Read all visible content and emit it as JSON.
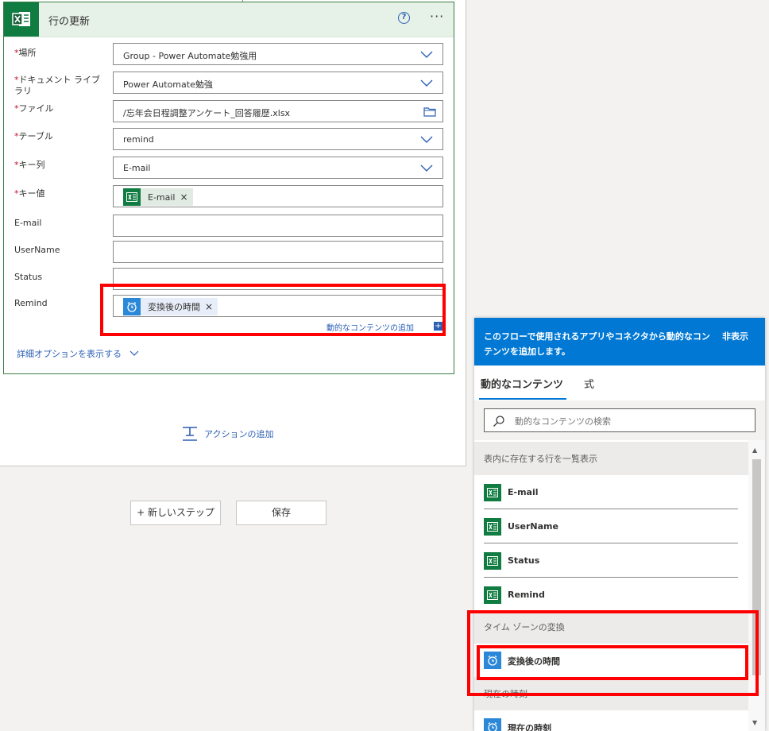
{
  "card": {
    "title": "行の更新",
    "help": "?",
    "more": "···",
    "fields": {
      "location": {
        "label": "場所",
        "value": "Group - Power Automate勉強用"
      },
      "doc_library": {
        "label_1": "ドキュメント ライブ",
        "label_2": "ラリ",
        "value": "Power Automate勉強"
      },
      "file": {
        "label": "ファイル",
        "value": "/忘年会日程調整アンケート_回答履歴.xlsx"
      },
      "table": {
        "label": "テーブル",
        "value": "remind"
      },
      "key_column": {
        "label": "キー列",
        "value": "E-mail"
      },
      "key_value": {
        "label": "キー値",
        "token": "E-mail"
      },
      "email": {
        "label": "E-mail",
        "value": ""
      },
      "username": {
        "label": "UserName",
        "value": ""
      },
      "status": {
        "label": "Status",
        "value": ""
      },
      "remind": {
        "label": "Remind",
        "token": "変換後の時間"
      }
    },
    "required_mark": "*",
    "token_close": "×",
    "add_dynamic": "動的なコンテンツの追加",
    "add_dynamic_plus": "+",
    "advanced_options": "詳細オプションを表示する"
  },
  "canvas": {
    "add_action": "アクションの追加",
    "new_step": "+ 新しいステップ",
    "save": "保存"
  },
  "panel": {
    "description": "このフローで使用されるアプリやコネクタから動的なコンテンツを追加します。",
    "hide": "非表示",
    "tabs": {
      "dynamic": "動的なコンテンツ",
      "expression": "式"
    },
    "search_placeholder": "動的なコンテンツの検索",
    "section1": {
      "title": "表内に存在する行を一覧表示",
      "items": [
        "E-mail",
        "UserName",
        "Status",
        "Remind"
      ]
    },
    "section2": {
      "title": "タイム ゾーンの変換",
      "items": [
        "変換後の時間"
      ]
    },
    "section3": {
      "title": "現在の時刻",
      "items": [
        "現在の時刻"
      ]
    }
  },
  "colors": {
    "excel_green": "#107c41",
    "accent_blue": "#0078d4",
    "highlight_red": "#ff0000"
  }
}
